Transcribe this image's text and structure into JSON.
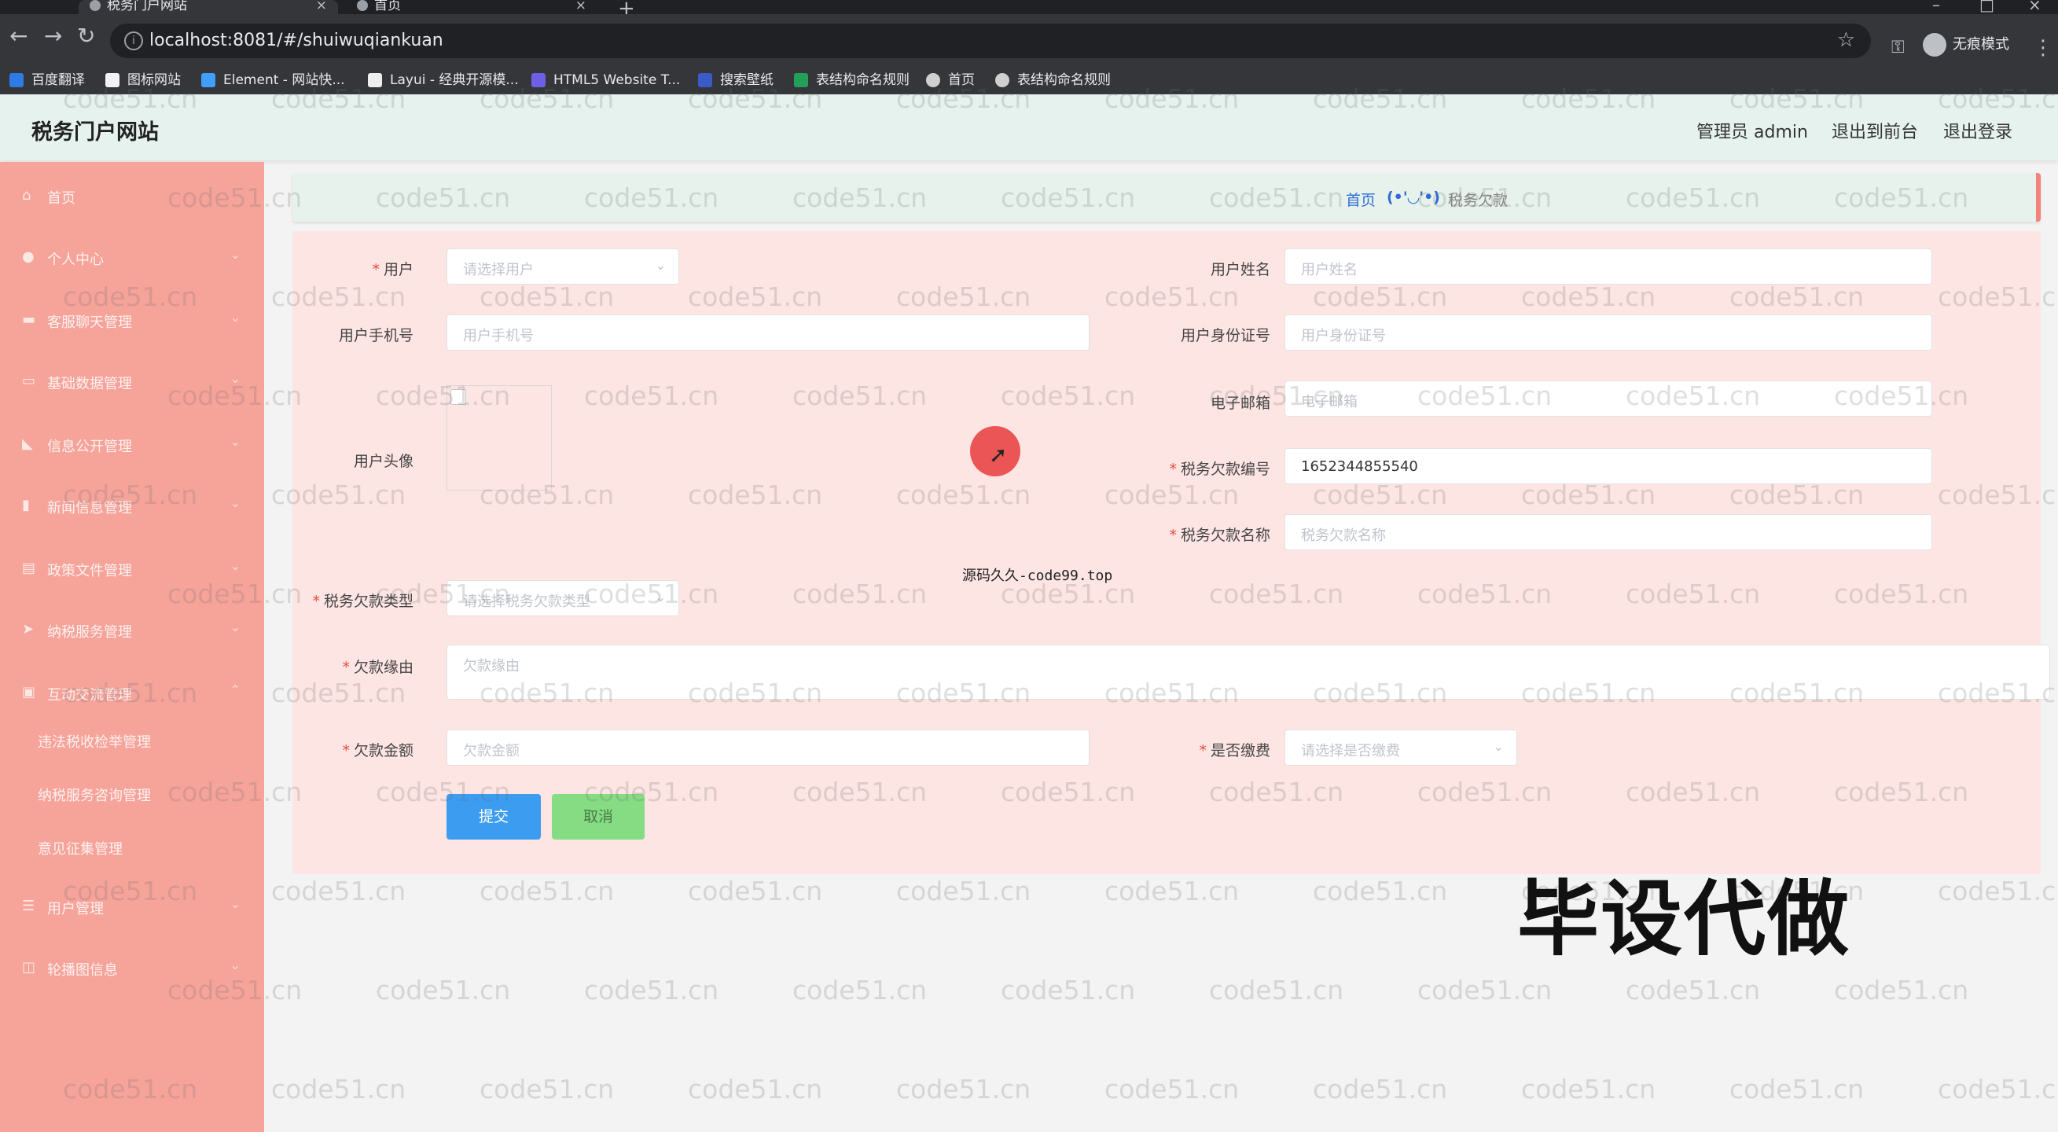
{
  "browser": {
    "tabs": [
      {
        "title": "税务门户网站",
        "active": true
      },
      {
        "title": "首页",
        "active": false
      }
    ],
    "url": "localhost:8081/#/shuiwuqiankuan",
    "incognito_label": "无痕模式",
    "bookmarks": [
      {
        "label": "百度翻译",
        "color": "#2f7be6"
      },
      {
        "label": "图标网站",
        "color": "#f2f2f2"
      },
      {
        "label": "Element - 网站快...",
        "color": "#409eff"
      },
      {
        "label": "Layui - 经典开源模...",
        "color": "#eeeeee"
      },
      {
        "label": "HTML5 Website T...",
        "color": "#6d5fe6"
      },
      {
        "label": "搜索壁纸",
        "color": "#3b5cc8"
      },
      {
        "label": "表结构命名规则",
        "color": "#22a05a"
      },
      {
        "label": "首页",
        "color": "#d0d0d0"
      },
      {
        "label": "表结构命名规则",
        "color": "#d0d0d0"
      }
    ]
  },
  "header": {
    "brand": "税务门户网站",
    "admin": "管理员 admin",
    "to_front": "退出到前台",
    "logout": "退出登录"
  },
  "sidebar": {
    "items": [
      {
        "label": "首页",
        "icon": "home-icon",
        "chev": false
      },
      {
        "label": "个人中心",
        "icon": "user-icon",
        "chev": true
      },
      {
        "label": "客服聊天管理",
        "icon": "chat-icon",
        "chev": true
      },
      {
        "label": "基础数据管理",
        "icon": "data-icon",
        "chev": true
      },
      {
        "label": "信息公开管理",
        "icon": "megaphone-icon",
        "chev": true
      },
      {
        "label": "新闻信息管理",
        "icon": "chart-icon",
        "chev": true
      },
      {
        "label": "政策文件管理",
        "icon": "file-icon",
        "chev": true
      },
      {
        "label": "纳税服务管理",
        "icon": "send-icon",
        "chev": true
      },
      {
        "label": "互动交流管理",
        "icon": "lock-icon",
        "chev": true
      }
    ],
    "sub_items": [
      "违法税收检举管理",
      "纳税服务咨询管理",
      "意见征集管理"
    ],
    "bottom_items": [
      {
        "label": "用户管理",
        "icon": "sliders-icon",
        "chev": true
      },
      {
        "label": "轮播图信息",
        "icon": "image-icon",
        "chev": true
      }
    ]
  },
  "breadcrumb": {
    "home": "首页",
    "emoji": "(•'◡'•)",
    "current": "税务欠款"
  },
  "form": {
    "user": {
      "label": "用户",
      "placeholder": "请选择用户"
    },
    "user_name": {
      "label": "用户姓名",
      "placeholder": "用户姓名"
    },
    "user_phone": {
      "label": "用户手机号",
      "placeholder": "用户手机号"
    },
    "user_id_card": {
      "label": "用户身份证号",
      "placeholder": "用户身份证号"
    },
    "email": {
      "label": "电子邮箱",
      "placeholder": "电子邮箱"
    },
    "avatar": {
      "label": "用户头像"
    },
    "debt_no": {
      "label": "税务欠款编号",
      "value": "1652344855540"
    },
    "debt_name": {
      "label": "税务欠款名称",
      "placeholder": "税务欠款名称"
    },
    "debt_type": {
      "label": "税务欠款类型",
      "placeholder": "请选择税务欠款类型"
    },
    "reason": {
      "label": "欠款缘由",
      "placeholder": "欠款缘由"
    },
    "amount": {
      "label": "欠款金额",
      "placeholder": "欠款金额"
    },
    "paid": {
      "label": "是否缴费",
      "placeholder": "请选择是否缴费"
    },
    "submit": "提交",
    "cancel": "取消"
  },
  "overlays": {
    "watermark_text": "code51.cn",
    "code_note": "源码久久-code99.top",
    "big_text": "毕设代做"
  },
  "colors": {
    "sidebar": "#f6a39a",
    "header": "#e6f2ee",
    "form_bg": "#fde5e3",
    "submit": "#3c9cf0",
    "cancel": "#85dc83",
    "accent": "#f2837a"
  }
}
